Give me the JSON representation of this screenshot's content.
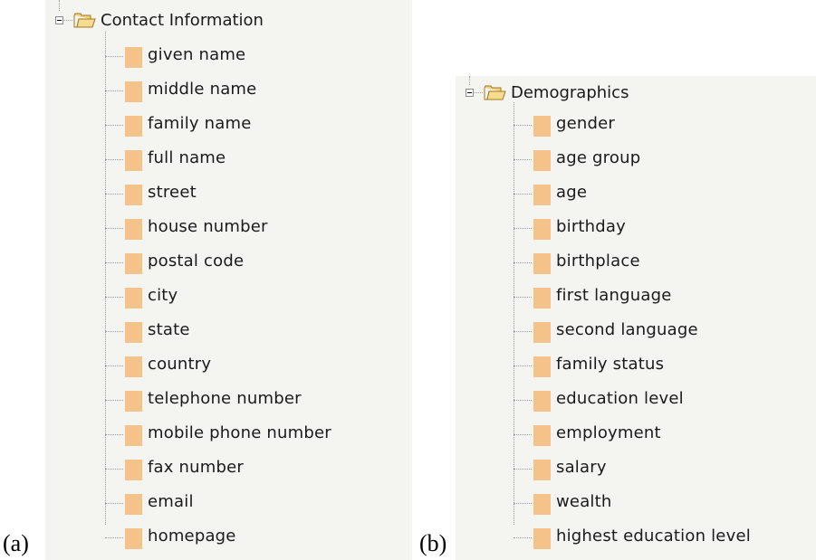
{
  "captions": {
    "a": "(a)",
    "b": "(b)"
  },
  "panel_a": {
    "root": {
      "label": "Contact Information",
      "icon": "folder-open-icon",
      "toggle": "collapse-icon"
    },
    "items": [
      "given name",
      "middle name",
      "family name",
      "full name",
      "street",
      "house number",
      "postal code",
      "city",
      "state",
      "country",
      "telephone number",
      "mobile phone number",
      "fax number",
      "email",
      "homepage"
    ]
  },
  "panel_b": {
    "root": {
      "label": "Demographics",
      "icon": "folder-open-icon",
      "toggle": "collapse-icon"
    },
    "items": [
      "gender",
      "age group",
      "age",
      "birthday",
      "birthplace",
      "first language",
      "second language",
      "family status",
      "education level",
      "employment",
      "salary",
      "wealth",
      "highest education level"
    ]
  },
  "colors": {
    "panel_bg": "#f4f4f1",
    "leaf_icon": "#f5c28a",
    "folder": "#f3d27c"
  }
}
